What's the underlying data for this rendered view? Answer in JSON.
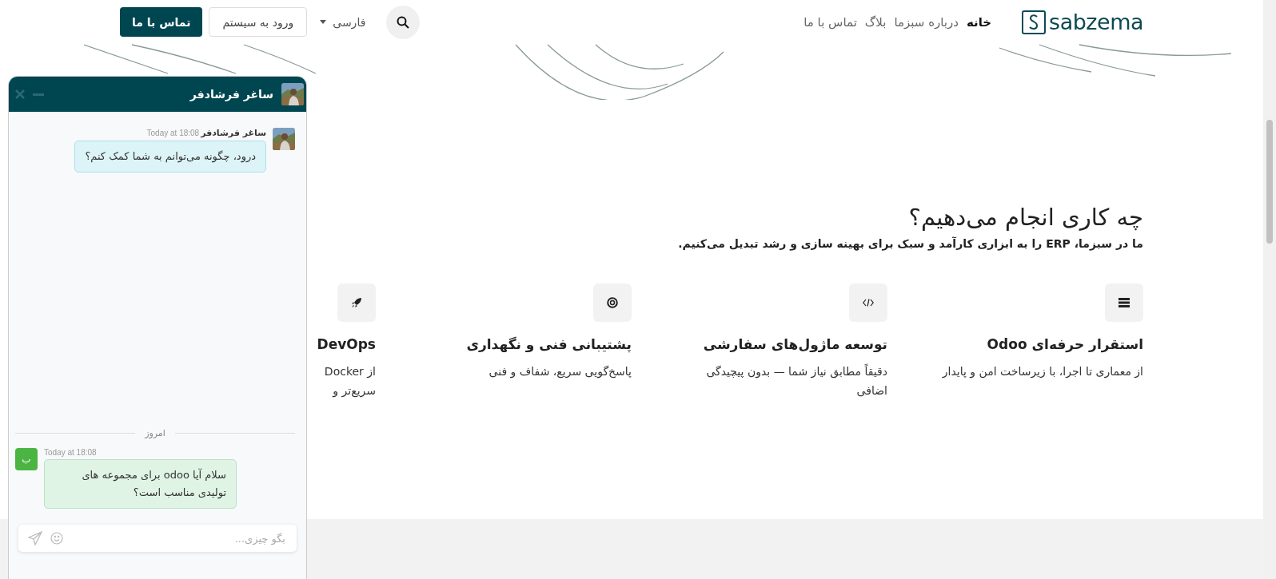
{
  "header": {
    "logo": "sabzema",
    "nav": [
      {
        "label": "خانه",
        "selected": true
      },
      {
        "label": "درباره سبزما",
        "selected": false
      },
      {
        "label": "بلاگ",
        "selected": false
      },
      {
        "label": "تماس با ما",
        "selected": false
      }
    ],
    "language": "فارسی",
    "login": "ورود به سیستم",
    "contact": "تماس با ما"
  },
  "section": {
    "title": "چه کاری انجام می‌دهیم؟",
    "subtitle": "ما در سبزما، ERP را به ابزاری کارآمد و سبک برای بهینه سازی و رشد تبدیل می‌کنیم.",
    "cards": [
      {
        "kind": "server",
        "title": "استقرار حرفه‌ای Odoo",
        "lines": [
          "از معماری تا اجرا، با زیرساخت امن و پایدار"
        ]
      },
      {
        "kind": "code",
        "title": "توسعه ماژول‌های سفارشی",
        "lines": [
          "دقیقاً مطابق نیاز شما — بدون پیچیدگی",
          "اضافی"
        ]
      },
      {
        "kind": "lifebuoy",
        "title": "پشتیبانی فنی و نگهداری",
        "lines": [
          "پاسخ‌گویی سریع، شفاف و فنی"
        ]
      },
      {
        "kind": "rocket",
        "title": "DevOps",
        "lines": [
          "از Docker",
          "سریع‌تر و"
        ]
      }
    ]
  },
  "chat": {
    "title": "ساغر فرشادفر",
    "messages": [
      {
        "kind": "agent",
        "author": "ساغر فرشادفر",
        "time": "Today at 18:08",
        "text": "درود، چگونه می‌توانم به شما کمک کنم؟"
      },
      {
        "kind": "divider",
        "text": "امروز"
      },
      {
        "kind": "visitor",
        "avatar": "ب",
        "time": "Today at 18:08",
        "text": "سلام آیا odoo برای مجموعه های تولیدی مناسب است؟"
      }
    ],
    "placeholder": "بگو چیزی..."
  }
}
